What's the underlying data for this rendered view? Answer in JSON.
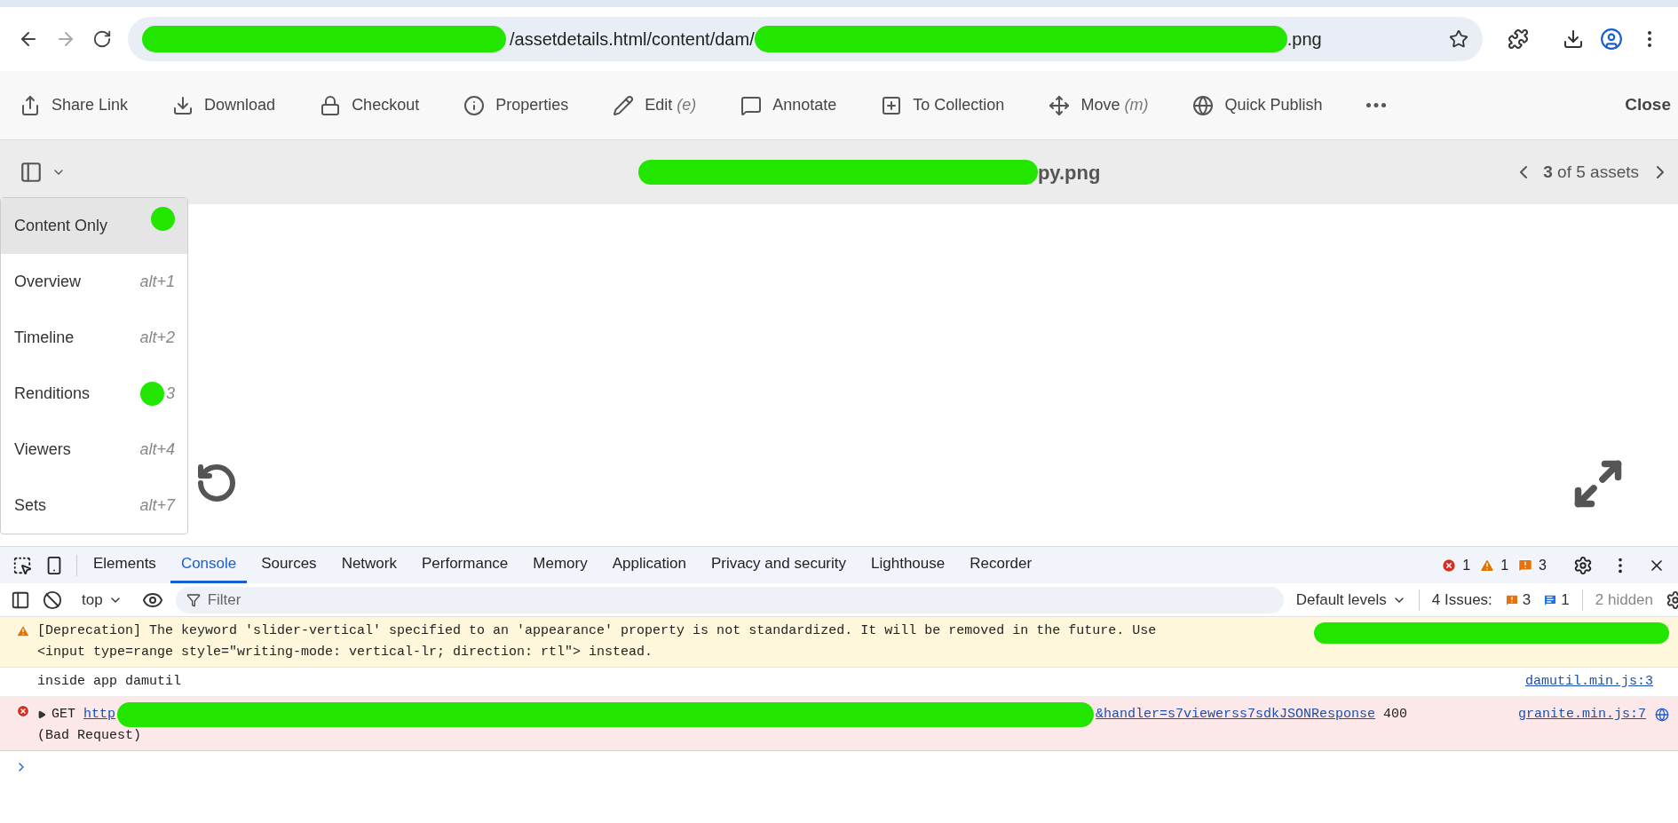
{
  "browser": {
    "url_parts": [
      "/assetdetails.html/content/dam/",
      ".png"
    ]
  },
  "toolbar": {
    "actions": [
      {
        "kind": "share",
        "label": "Share Link"
      },
      {
        "kind": "download",
        "label": "Download"
      },
      {
        "kind": "lock",
        "label": "Checkout"
      },
      {
        "kind": "info",
        "label": "Properties"
      },
      {
        "kind": "edit",
        "label": "Edit",
        "shortcut": "(e)"
      },
      {
        "kind": "annotate",
        "label": "Annotate"
      },
      {
        "kind": "collection",
        "label": "To Collection"
      },
      {
        "kind": "move",
        "label": "Move",
        "shortcut": "(m)"
      },
      {
        "kind": "publish",
        "label": "Quick Publish"
      },
      {
        "kind": "more"
      }
    ],
    "close": "Close"
  },
  "header": {
    "title_tail": "py.png",
    "pager_current": "3",
    "pager_rest": "of 5 assets"
  },
  "view_menu": {
    "items": [
      {
        "label": "Content Only",
        "selected": true
      },
      {
        "label": "Overview",
        "shortcut": "alt+1",
        "selected": false
      },
      {
        "label": "Timeline",
        "shortcut": "alt+2",
        "selected": false
      },
      {
        "label": "Renditions",
        "shortcut": "3",
        "selected": false
      },
      {
        "label": "Viewers",
        "shortcut": "alt+4",
        "selected": false
      },
      {
        "label": "Sets",
        "shortcut": "alt+7",
        "selected": false
      }
    ]
  },
  "devtools": {
    "tabs": [
      {
        "label": "Elements",
        "selected": false
      },
      {
        "label": "Console",
        "selected": true
      },
      {
        "label": "Sources",
        "selected": false
      },
      {
        "label": "Network",
        "selected": false
      },
      {
        "label": "Performance",
        "selected": false
      },
      {
        "label": "Memory",
        "selected": false
      },
      {
        "label": "Application",
        "selected": false
      },
      {
        "label": "Privacy and security",
        "selected": false
      },
      {
        "label": "Lighthouse",
        "selected": false
      },
      {
        "label": "Recorder",
        "selected": false
      }
    ],
    "error_count": "1",
    "warning_count": "1",
    "issue_count": "3",
    "context": "top",
    "filter_placeholder": "Filter",
    "levels": "Default levels",
    "issues_label": "4 Issues:",
    "issues_warning": "3",
    "issues_info": "1",
    "hidden": "2 hidden"
  },
  "messages": [
    {
      "kind": "warning",
      "lines": [
        "[Deprecation] The keyword 'slider-vertical' specified to an 'appearance' property is not standardized. It will be removed in the future. Use",
        "<input type=range style=\"writing-mode: vertical-lr; direction: rtl\"> instead."
      ]
    },
    {
      "kind": "log",
      "lines": [
        "inside app damutil"
      ],
      "source": "damutil.min.js:3"
    },
    {
      "kind": "error",
      "method": "GET",
      "link_start": "http",
      "link_end": "&handler=s7viewerss7sdkJSONResponse",
      "status": "400",
      "lines": [
        "(Bad Request)"
      ],
      "source": "granite.min.js:7"
    }
  ]
}
